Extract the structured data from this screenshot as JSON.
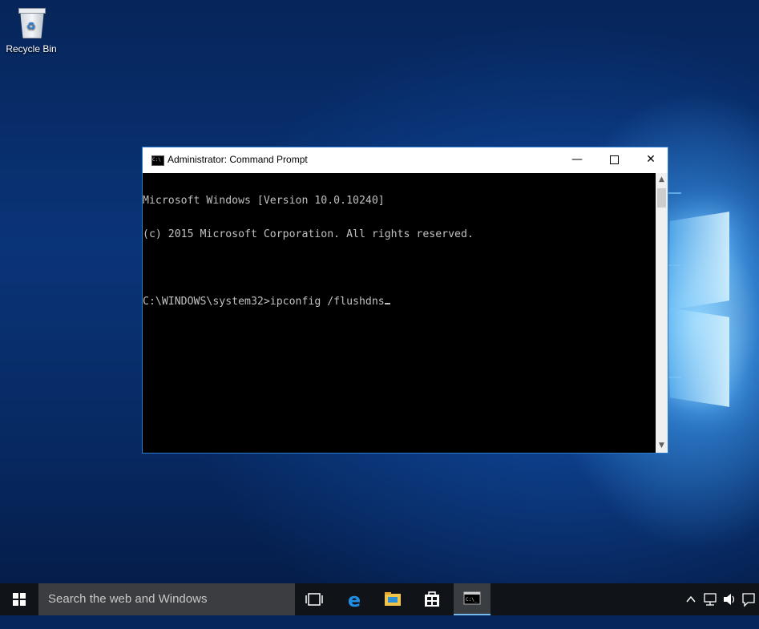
{
  "desktop": {
    "icons": [
      {
        "label": "Recycle Bin",
        "icon": "recycle-bin-icon"
      }
    ]
  },
  "window": {
    "title": "Administrator: Command Prompt",
    "icon": "cmd-icon",
    "controls": {
      "minimize": "—",
      "maximize": "□",
      "close": "✕"
    },
    "console_lines": [
      "Microsoft Windows [Version 10.0.10240]",
      "(c) 2015 Microsoft Corporation. All rights reserved.",
      "",
      "C:\\WINDOWS\\system32>ipconfig /flushdns"
    ]
  },
  "taskbar": {
    "search_placeholder": "Search the web and Windows",
    "apps": [
      {
        "name": "task-view",
        "icon": "task-view-icon"
      },
      {
        "name": "edge",
        "icon": "edge-icon"
      },
      {
        "name": "file-explorer",
        "icon": "folder-icon"
      },
      {
        "name": "store",
        "icon": "store-icon"
      },
      {
        "name": "command-prompt",
        "icon": "cmd-icon",
        "active": true
      }
    ],
    "tray": [
      "chevron-up-icon",
      "network-icon",
      "volume-icon",
      "notifications-icon"
    ]
  },
  "colors": {
    "accent": "#76b9ed",
    "console_bg": "#000000",
    "console_fg": "#c0c0c0",
    "taskbar_bg": "#101318"
  }
}
